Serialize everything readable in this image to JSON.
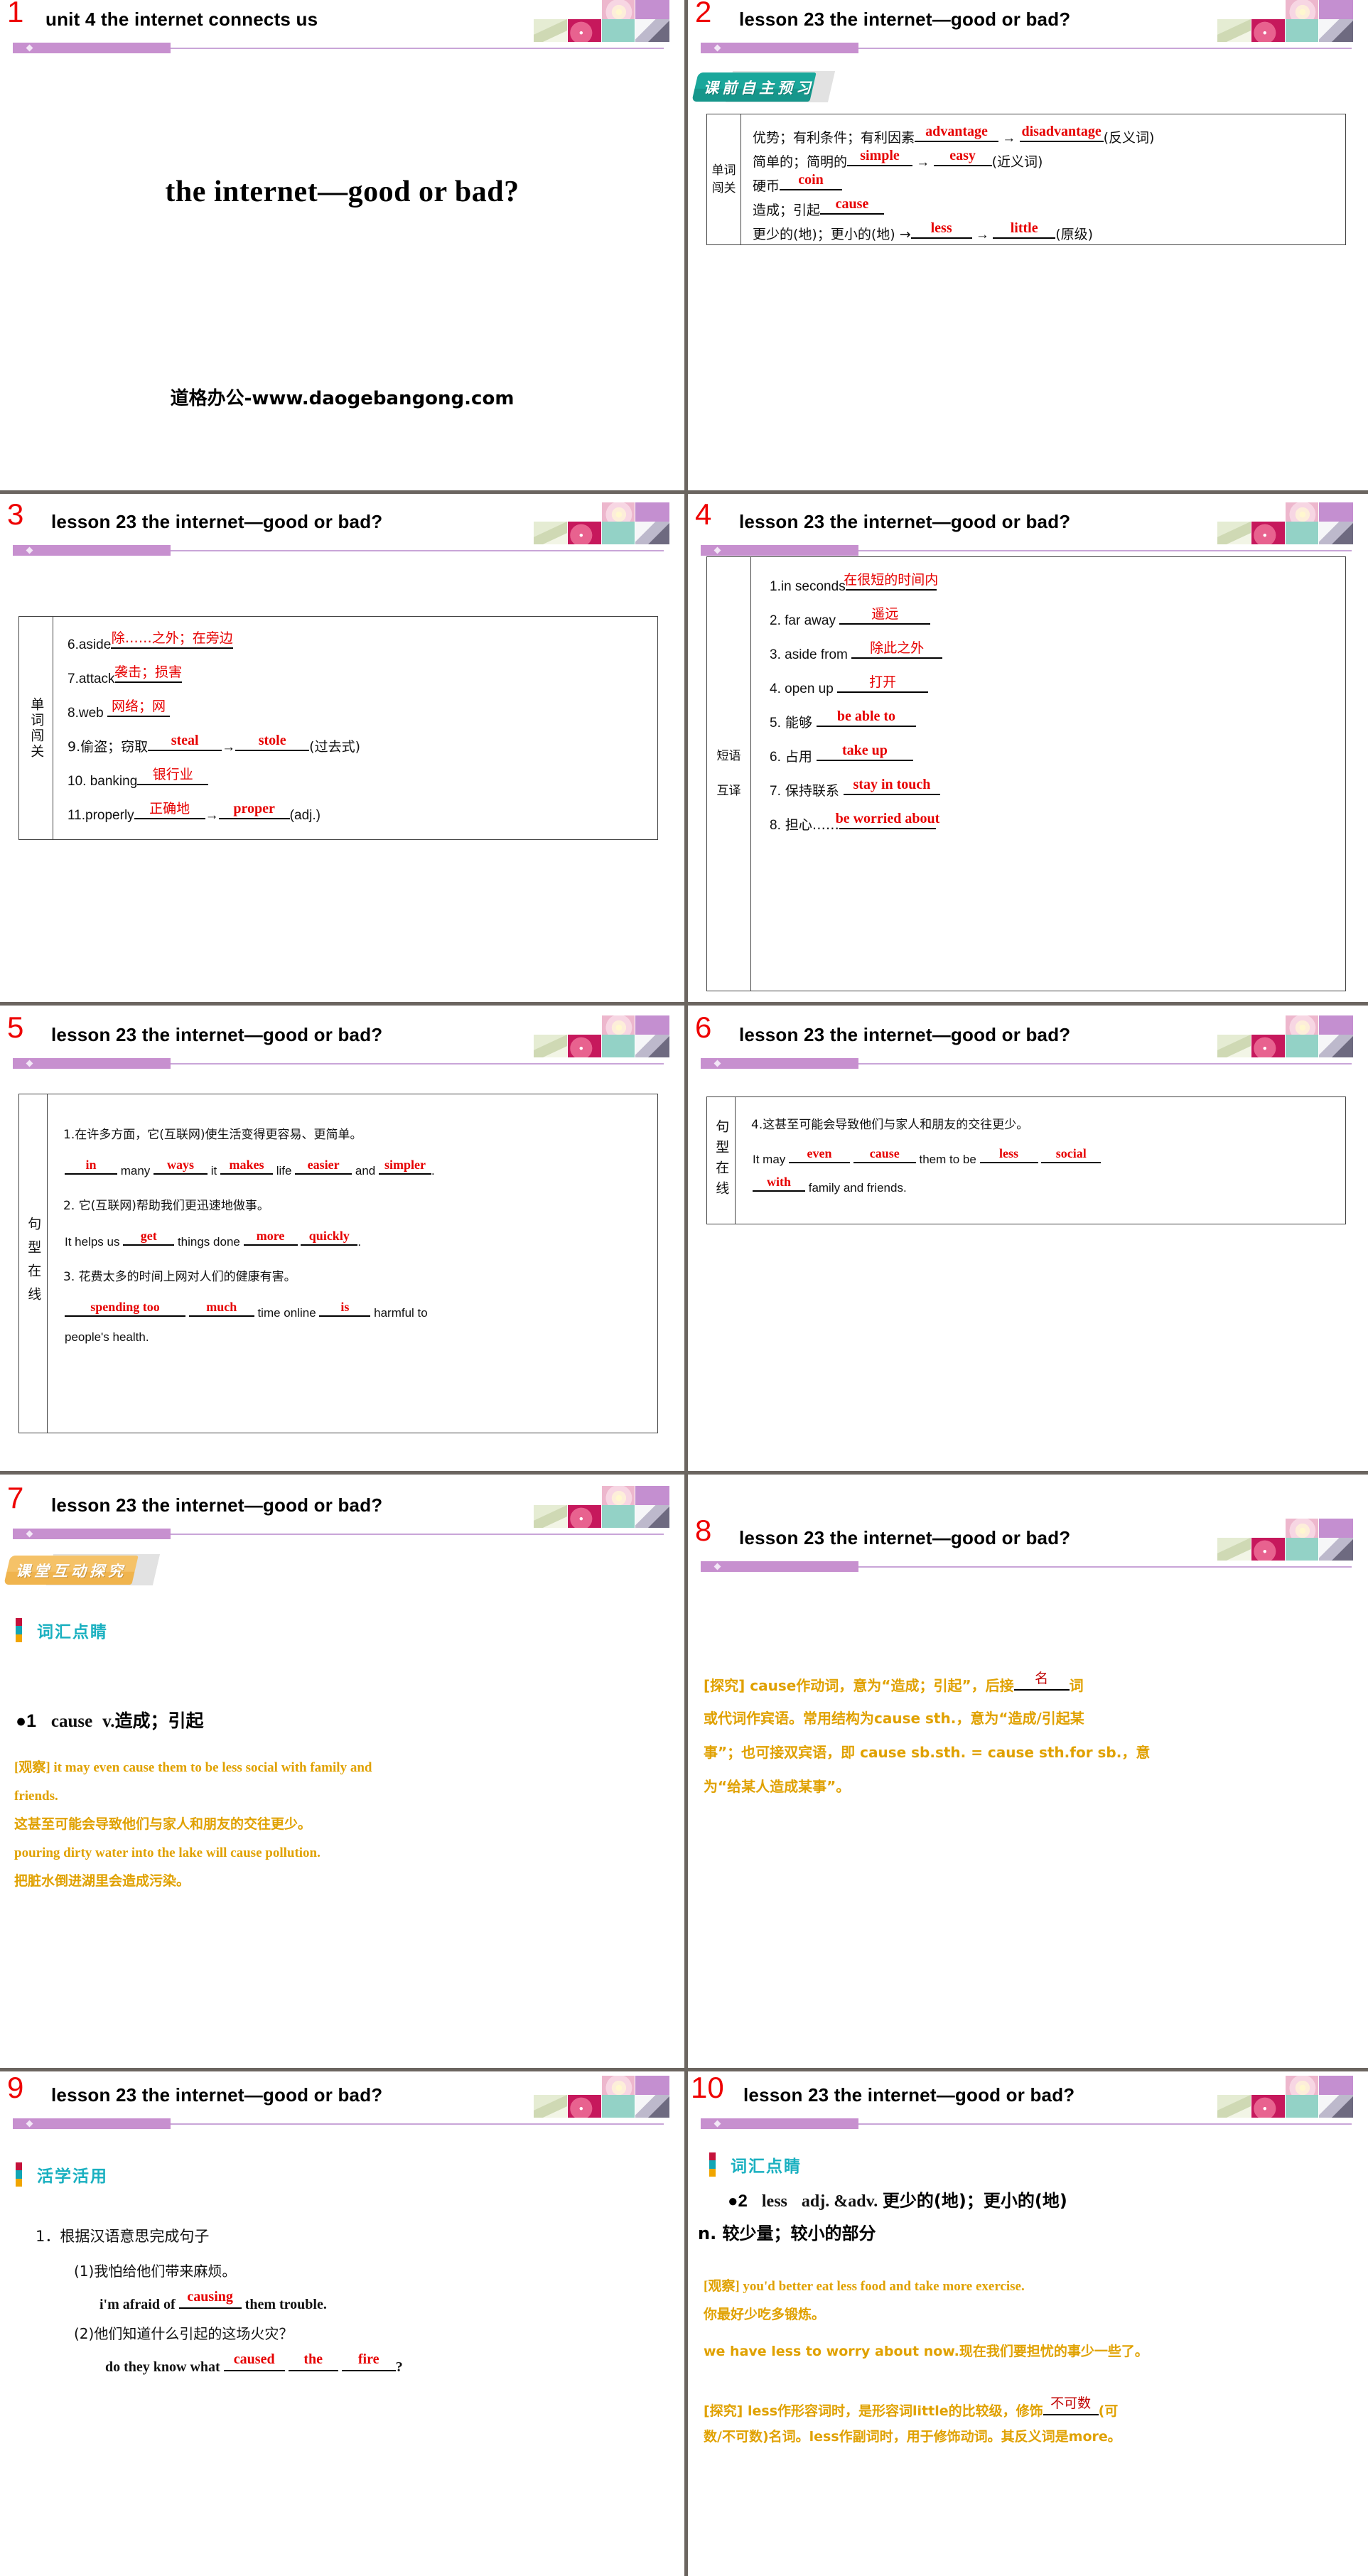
{
  "deck": {
    "slide_count": 10,
    "accent_purple": "#c790cf",
    "accent_red": "#ee0000",
    "accent_gold": "#e0a100",
    "accent_teal": "#1aa79b",
    "accent_orange": "#f5c268",
    "grid_gray": "#6b6560"
  },
  "slides": [
    {
      "number": "1",
      "title": "unit 4   the internet connects us",
      "cover_title": "the internet—good or bad?",
      "cover_url": "道格办公-www.daogebangong.com"
    },
    {
      "number": "2",
      "title": "lesson 23   the internet—good or bad?",
      "banner": "课前自主预习",
      "table_label": "单词\n闯关",
      "rows": [
        {
          "no": "1.",
          "prompt": "优势；有利条件；有利因素",
          "answers": [
            "advantage",
            "disadvantage"
          ],
          "arrow": true,
          "suffix": "(反义词)"
        },
        {
          "no": "2.",
          "prompt": "简单的；简明的",
          "answers": [
            "simple",
            "easy"
          ],
          "arrow": true,
          "suffix": "(近义词)"
        },
        {
          "no": "3.",
          "prompt": "硬币",
          "answers": [
            "coin"
          ],
          "arrow": false,
          "suffix": ""
        },
        {
          "no": "4.",
          "prompt": "造成；引起",
          "answers": [
            "cause"
          ],
          "arrow": false,
          "suffix": ""
        },
        {
          "no": "5.",
          "prompt": "更少的(地)；更小的(地) →",
          "answers": [
            "less",
            "little"
          ],
          "arrow": true,
          "suffix": "(原级)"
        }
      ]
    },
    {
      "number": "3",
      "title": "lesson 23   the internet—good or bad?",
      "table_label": "单词闯关",
      "rows": [
        {
          "no": "6.",
          "word": "aside",
          "answers": [
            "除……之外；在旁边"
          ],
          "suffix": ""
        },
        {
          "no": "7.",
          "word": "attack",
          "answers": [
            "袭击；损害"
          ],
          "suffix": ""
        },
        {
          "no": "8.",
          "word": "web ",
          "answers": [
            "网络；网"
          ],
          "suffix": ""
        },
        {
          "no": "9.",
          "word": "偷盗；窃取",
          "answers": [
            "steal",
            "stole"
          ],
          "suffix": "(过去式)"
        },
        {
          "no": "10.",
          "word": " banking",
          "answers": [
            "银行业"
          ],
          "suffix": ""
        },
        {
          "no": "11.",
          "word": "properly",
          "answers": [
            "正确地",
            "proper"
          ],
          "suffix": "(adj.)"
        }
      ]
    },
    {
      "number": "4",
      "title": "lesson 23   the internet—good or bad?",
      "table_label": "短语\n互译",
      "rows": [
        {
          "no": "1.",
          "word": "in seconds",
          "answer": "在很短的时间内"
        },
        {
          "no": "2.",
          "word": " far away ",
          "answer": "遥远"
        },
        {
          "no": "3.",
          "word": " aside from ",
          "answer": "除此之外"
        },
        {
          "no": "4.",
          "word": " open up ",
          "answer": "打开"
        },
        {
          "no": "5.",
          "word": " 能够 ",
          "answer": "be able to"
        },
        {
          "no": "6.",
          "word": " 占用 ",
          "answer": "take up"
        },
        {
          "no": "7.",
          "word": " 保持联系 ",
          "answer": "stay in touch"
        },
        {
          "no": "8.",
          "word": " 担心……",
          "answer": "be worried about"
        }
      ]
    },
    {
      "number": "5",
      "title": "lesson 23   the internet—good or bad?",
      "table_label": "句型在线",
      "items": [
        {
          "cn": "1.在许多方面，它(互联网)使生活变得更容易、更简单。",
          "en_parts": [
            "",
            " many ",
            " it ",
            " life ",
            " and ",
            "."
          ],
          "answers": [
            "in",
            "ways",
            "makes",
            "easier",
            "simpler"
          ]
        },
        {
          "cn": "2. 它(互联网)帮助我们更迅速地做事。",
          "en_parts": [
            "It helps us ",
            " things done ",
            " ",
            "."
          ],
          "answers": [
            "get",
            "more",
            "quickly"
          ]
        },
        {
          "cn": "3. 花费太多的时间上网对人们的健康有害。",
          "en_parts": [
            "",
            " ",
            " time online ",
            " harmful to"
          ],
          "answers": [
            "spending too",
            "much",
            "is"
          ],
          "tail": "people's health."
        }
      ]
    },
    {
      "number": "6",
      "title": "lesson 23   the internet—good or bad?",
      "table_label": "句型在线",
      "items": [
        {
          "cn": "4.这甚至可能会导致他们与家人和朋友的交往更少。",
          "en_parts": [
            "It may ",
            " ",
            " them to be ",
            " ",
            ""
          ],
          "answers": [
            "even",
            "cause",
            "less",
            "social"
          ],
          "tail_parts": [
            "",
            " family and friends."
          ],
          "tail_answers": [
            "with"
          ]
        }
      ]
    },
    {
      "number": "7",
      "title": "lesson 23   the internet—good or bad?",
      "banner": "课堂互动探究",
      "section_label": "词汇点睛",
      "entry_bullet": "●",
      "entry_no": "1",
      "entry_word": "cause",
      "entry_pos": "v.",
      "entry_meaning": "造成；引起",
      "notes": [
        {
          "tag": "[观察]",
          "text": " it may even cause them to be less social with family and",
          "style": "en"
        },
        {
          "tag": "",
          "text": "friends.",
          "style": "en"
        },
        {
          "tag": "",
          "text": "这甚至可能会导致他们与家人和朋友的交往更少。",
          "style": "cn"
        },
        {
          "tag": "",
          "text": "pouring dirty water into the lake will cause pollution.",
          "style": "en"
        },
        {
          "tag": "",
          "text": "把脏水倒进湖里会造成污染。",
          "style": "cn"
        }
      ]
    },
    {
      "number": "8",
      "title": "lesson 23   the internet—good or bad?",
      "paragraph_lines": [
        {
          "pre": "[探究] cause作动词，意为“造成；引起”，后接",
          "blank": "名",
          "post": "词"
        },
        {
          "pre": "或代词作宾语。常用结构为cause sth.，意为“造成/引起某",
          "blank": "",
          "post": ""
        },
        {
          "pre": "事”；也可接双宾语，即 cause sb.sth. = cause sth.for sb.，意",
          "blank": "",
          "post": ""
        },
        {
          "pre": "为“给某人造成某事”。",
          "blank": "",
          "post": ""
        }
      ]
    },
    {
      "number": "9",
      "title": "lesson 23   the internet—good or bad?",
      "section_label": "活学活用",
      "exercise_heading": "1．根据汉语意思完成句子",
      "questions": [
        {
          "cn": "(1)我怕给他们带来麻烦。",
          "en_parts": [
            "i'm afraid of ",
            " them trouble."
          ],
          "answers": [
            "causing"
          ]
        },
        {
          "cn": "(2)他们知道什么引起的这场火灾？",
          "en_parts": [
            "do they know what ",
            " ",
            " ",
            "?"
          ],
          "answers": [
            "caused",
            "the",
            "fire"
          ]
        }
      ]
    },
    {
      "number": "10",
      "title": "lesson 23   the internet—good or bad?",
      "section_label": "词汇点睛",
      "entry_bullet": "●",
      "entry_no": "2",
      "entry_word": "less",
      "entry_pos": "adj. &adv.",
      "entry_meaning": "更少的(地)；更小的(地)",
      "entry_meaning2": "n. 较少量；较小的部分",
      "notes": [
        {
          "tag": "[观察]",
          "text": " you'd better eat less food and take more exercise.",
          "style": "en"
        },
        {
          "tag": "",
          "text": "你最好少吃多锻炼。",
          "style": "cn"
        },
        {
          "tag": "",
          "text": "we have less to worry about now.现在我们要担忧的事少一些了。",
          "style": "mix"
        }
      ],
      "explore_lines": [
        {
          "pre": "[探究] less作形容词时，是形容词little的比较级，修饰",
          "blank": "不可数",
          "post": "(可"
        },
        {
          "pre": "数/不可数)名词。less作副词时，用于修饰动词。其反义词是more。",
          "blank": "",
          "post": ""
        }
      ]
    }
  ]
}
